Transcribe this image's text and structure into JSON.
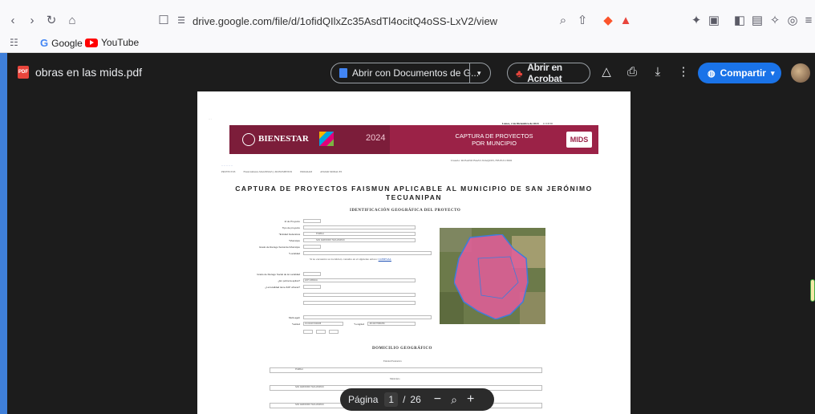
{
  "browser": {
    "url": "drive.google.com/file/d/1ofidQIlxZc35AsdTl4ocitQ4oSS-LxV2/view",
    "bookmarks": [
      {
        "label": "Google"
      },
      {
        "label": "YouTube"
      }
    ]
  },
  "viewer": {
    "file_name": "obras en las mids.pdf",
    "open_with_label": "Abrir con Documentos de G...",
    "acrobat_label": "Abrir en Acrobat",
    "share_label": "Compartir"
  },
  "document": {
    "date_line": "Lunes, 2 de Diciembre de 2024",
    "time": "11:16:56",
    "user_line": "Usuario: ROSANO BAZO JOAQUIN, FPUE2113602",
    "banner_left": "BIENESTAR",
    "banner_year": "2024",
    "banner_center_1": "CAPTURA DE PROYECTOS",
    "banner_center_2": "POR MUNCIPIO",
    "banner_right": "MIDS",
    "menu_items": [
      "PROYECTOS",
      "Financiamiento-MAGNIMAS y MONUMENTOS",
      "PROGRAM",
      "AVATAR MODAL/ES"
    ],
    "title_line_1": "CAPTURA DE PROYECTOS FAISMUN APLICABLE AL MUNICIPIO DE SAN JERÓNIMO",
    "title_line_2": "TECUANIPAN",
    "section_geo": "IDENTIFICACIÓN GEOGRÁFICA DEL PROYECTO",
    "section_dom": "DOMICILIO GEOGRÁFICO",
    "field_labels": [
      "Id de Proyecto",
      "Tipo de proyecto",
      "*Entidad Federativa",
      "*Municipio",
      "Grado de Rezago Social del Municipio",
      "*Localidad",
      "Grado de Rezago Social de la Localidad",
      "¿En pobreza aplica?",
      "¿La localidad tiene ZAP urbana?",
      "Multi-ageb",
      "*Latitud",
      "*Longitud"
    ],
    "field_values": [
      "PUEBLA",
      "SAN JERONIMO TECUANIPAN",
      "ZAP URBANA",
      "19.016437190188",
      "-98.40077881850"
    ],
    "note_link": "CONEVAL",
    "entidad_label": "Entidad Federativa",
    "municipio_label": "Municipio",
    "row_values": [
      "PUEBLA",
      "SAN JERONIMO TECUANIPAN",
      "SAN JERONIMO TECUANIPAN"
    ]
  },
  "pagination": {
    "page_label": "Página",
    "current_page": "1",
    "separator": "/",
    "total_pages": "26"
  }
}
